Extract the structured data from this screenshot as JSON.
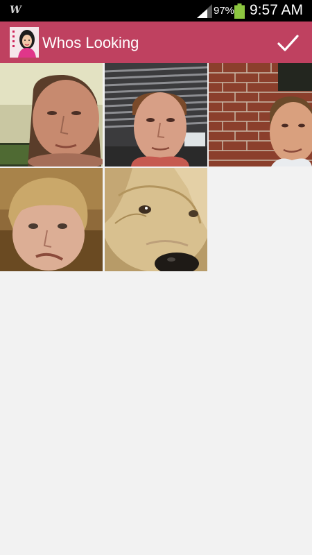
{
  "status_bar": {
    "notification_glyph": "W",
    "battery_percent": "97%",
    "time": "9:57 AM",
    "icons": [
      "signal-icon",
      "battery-icon"
    ]
  },
  "action_bar": {
    "title": "Whos Looking",
    "app_icon": "app-logo-icon",
    "done_icon": "checkmark-icon"
  },
  "photos": [
    {
      "id": "photo-1",
      "subject": "face"
    },
    {
      "id": "photo-2",
      "subject": "face"
    },
    {
      "id": "photo-3",
      "subject": "face"
    },
    {
      "id": "photo-4",
      "subject": "face"
    },
    {
      "id": "photo-5",
      "subject": "dog"
    }
  ],
  "colors": {
    "action_bar": "#bf4160",
    "background": "#f2f2f2",
    "battery": "#8cc63f"
  }
}
